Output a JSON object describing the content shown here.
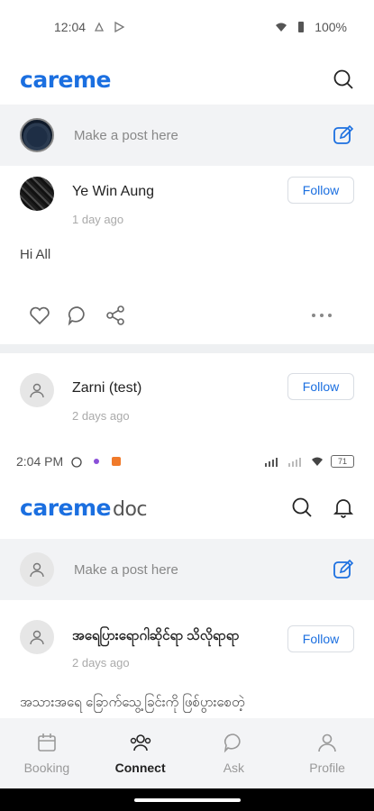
{
  "status_bar": {
    "time": "12:04",
    "battery": "100%"
  },
  "header1": {
    "logo": "careme",
    "search_icon": "search-icon"
  },
  "composer1": {
    "placeholder": "Make a post here"
  },
  "post1": {
    "author": "Ye Win Aung",
    "time": "1 day ago",
    "follow": "Follow",
    "body": "Hi All",
    "actions": [
      "heart-icon",
      "comment-icon",
      "share-icon",
      "more-icon"
    ]
  },
  "post2": {
    "author": "Zarni (test)",
    "time": "2 days ago",
    "follow": "Follow"
  },
  "status_bar2": {
    "time": "2:04 PM",
    "battery": "71"
  },
  "header2": {
    "logo": "careme",
    "logo_suffix": "doc"
  },
  "composer2": {
    "placeholder": "Make a post here"
  },
  "post3": {
    "author": "အရေပြားရောဂါဆိုင်ရာ သိလိုရာရာ",
    "time": "2 days ago",
    "follow": "Follow",
    "body": "အသားအရေ ခြောက်သွေ့ခြင်းကို ဖြစ်ပွားစေတဲ့"
  },
  "bottom_nav": {
    "items": [
      {
        "label": "Booking",
        "icon": "calendar-icon"
      },
      {
        "label": "Connect",
        "icon": "people-icon",
        "active": true
      },
      {
        "label": "Ask",
        "icon": "chat-icon"
      },
      {
        "label": "Profile",
        "icon": "user-icon"
      }
    ]
  },
  "colors": {
    "brand": "#1b6fe0",
    "muted": "#999999",
    "panel": "#f2f3f5"
  }
}
